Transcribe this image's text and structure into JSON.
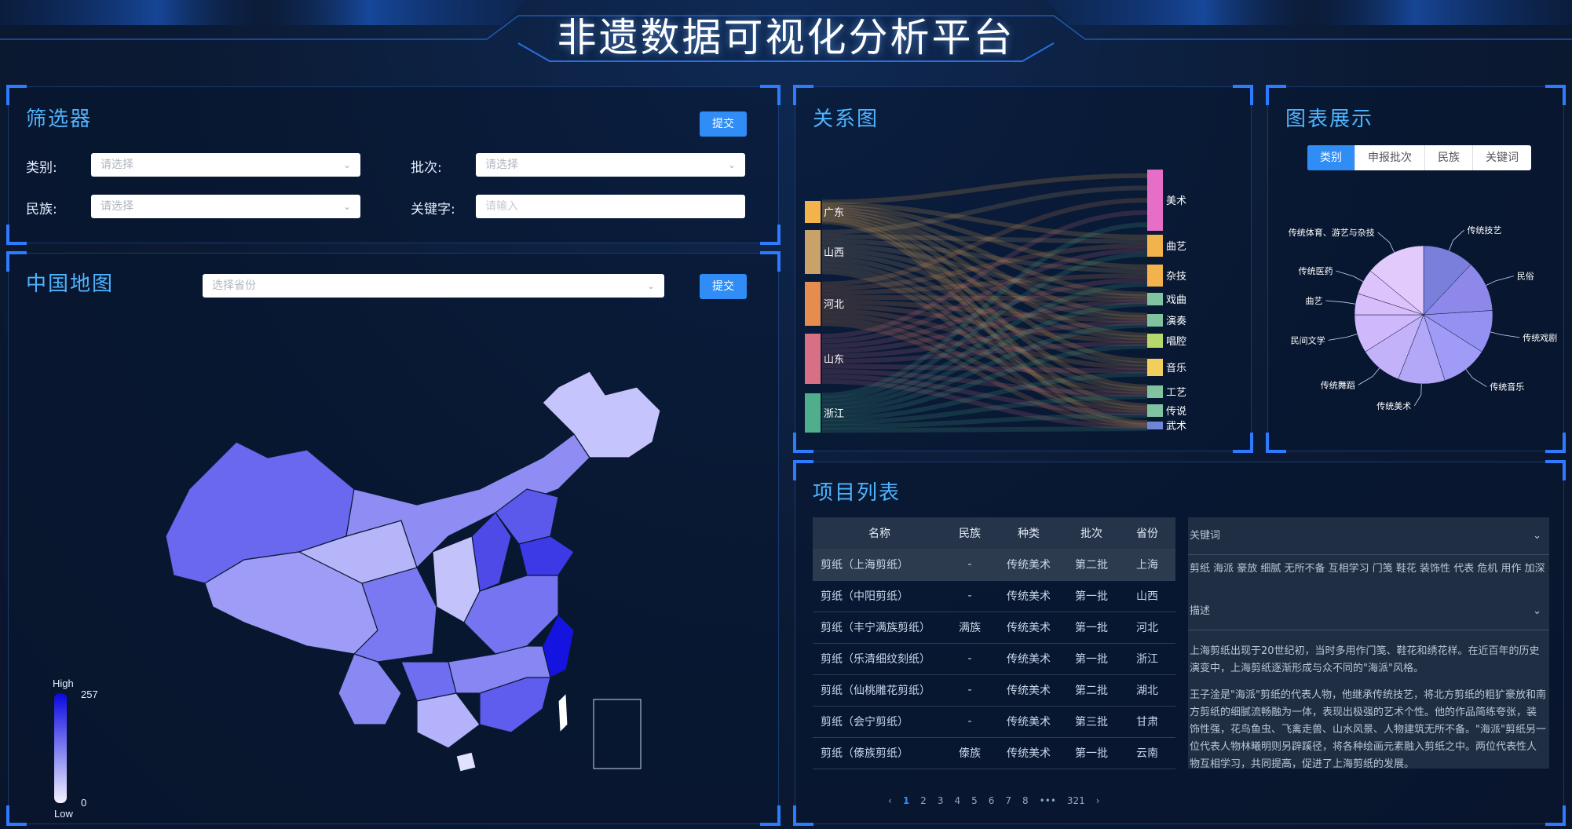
{
  "header": {
    "title": "非遗数据可视化分析平台"
  },
  "filter": {
    "title": "筛选器",
    "submit": "提交",
    "category_label": "类别:",
    "category_placeholder": "请选择",
    "batch_label": "批次:",
    "batch_placeholder": "请选择",
    "ethnic_label": "民族:",
    "ethnic_placeholder": "请选择",
    "keyword_label": "关键字:",
    "keyword_placeholder": "请输入"
  },
  "map": {
    "title": "中国地图",
    "province_placeholder": "选择省份",
    "submit": "提交",
    "legend": {
      "high": "High",
      "low": "Low",
      "max": "257",
      "min": "0"
    }
  },
  "sankey": {
    "title": "关系图",
    "sources": [
      "广东",
      "山西",
      "河北",
      "山东",
      "浙江"
    ],
    "targets": [
      "美术",
      "曲艺",
      "杂技",
      "戏曲",
      "演奏",
      "唱腔",
      "音乐",
      "工艺",
      "传说",
      "武术"
    ],
    "colors": {
      "sources": [
        "#f3b34c",
        "#c9a26a",
        "#e68c4f",
        "#d87085",
        "#4fae8c"
      ],
      "targets": [
        "#e66ec6",
        "#f3b34c",
        "#f3b34c",
        "#7fc3a0",
        "#7fc3a0",
        "#b7d86a",
        "#f0cf5c",
        "#7fc3a0",
        "#7fc3a0",
        "#6f86d6"
      ]
    }
  },
  "pie": {
    "title": "图表展示",
    "tabs": [
      "类别",
      "申报批次",
      "民族",
      "关键词"
    ],
    "active_tab": "类别",
    "labels": [
      "传统技艺",
      "民俗",
      "传统戏剧",
      "传统音乐",
      "传统美术",
      "传统舞蹈",
      "民间文学",
      "曲艺",
      "传统医药",
      "传统体育、游艺与杂技"
    ],
    "colors": {
      "slices": [
        "#7b7fdc",
        "#8d88ea",
        "#9591f2",
        "#a09bf6",
        "#b3a8f8",
        "#c3b2fa",
        "#cfb8fb",
        "#d7bdfb",
        "#dcc3fc",
        "#e2cafd"
      ]
    }
  },
  "projects": {
    "title": "项目列表",
    "columns": [
      "名称",
      "民族",
      "种类",
      "批次",
      "省份"
    ],
    "rows": [
      [
        "剪纸（上海剪纸）",
        "-",
        "传统美术",
        "第二批",
        "上海"
      ],
      [
        "剪纸（中阳剪纸）",
        "-",
        "传统美术",
        "第一批",
        "山西"
      ],
      [
        "剪纸（丰宁满族剪纸）",
        "满族",
        "传统美术",
        "第一批",
        "河北"
      ],
      [
        "剪纸（乐清细纹刻纸）",
        "-",
        "传统美术",
        "第一批",
        "浙江"
      ],
      [
        "剪纸（仙桃雕花剪纸）",
        "-",
        "传统美术",
        "第二批",
        "湖北"
      ],
      [
        "剪纸（会宁剪纸）",
        "-",
        "传统美术",
        "第三批",
        "甘肃"
      ],
      [
        "剪纸（傣族剪纸）",
        "傣族",
        "传统美术",
        "第一批",
        "云南"
      ]
    ],
    "keywords_label": "关键词",
    "keywords": "剪纸 海派 豪放 细腻 无所不备 互相学习 门笺 鞋花 装饰性 代表 危机 用作 加深",
    "desc_label": "描述",
    "desc_p1": "上海剪纸出现于20世纪初，当时多用作门笺、鞋花和绣花样。在近百年的历史演变中，上海剪纸逐渐形成与众不同的\"海派\"风格。",
    "desc_p2": "王子淦是\"海派\"剪纸的代表人物，他继承传统技艺，将北方剪纸的粗犷豪放和南方剪纸的细腻流畅融为一体，表现出极强的艺术个性。他的作品简练夸张，装饰性强，花鸟鱼虫、飞禽走兽、山水风景、人物建筑无所不备。\"海派\"剪纸另一位代表人物林曦明则另辟蹊径，将各种绘画元素融入剪纸之中。两位代表性人物互相学习，共同提高，促进了上海剪纸的发展。",
    "pager": [
      "1",
      "2",
      "3",
      "4",
      "5",
      "6",
      "7",
      "8",
      "•••",
      "321"
    ]
  }
}
